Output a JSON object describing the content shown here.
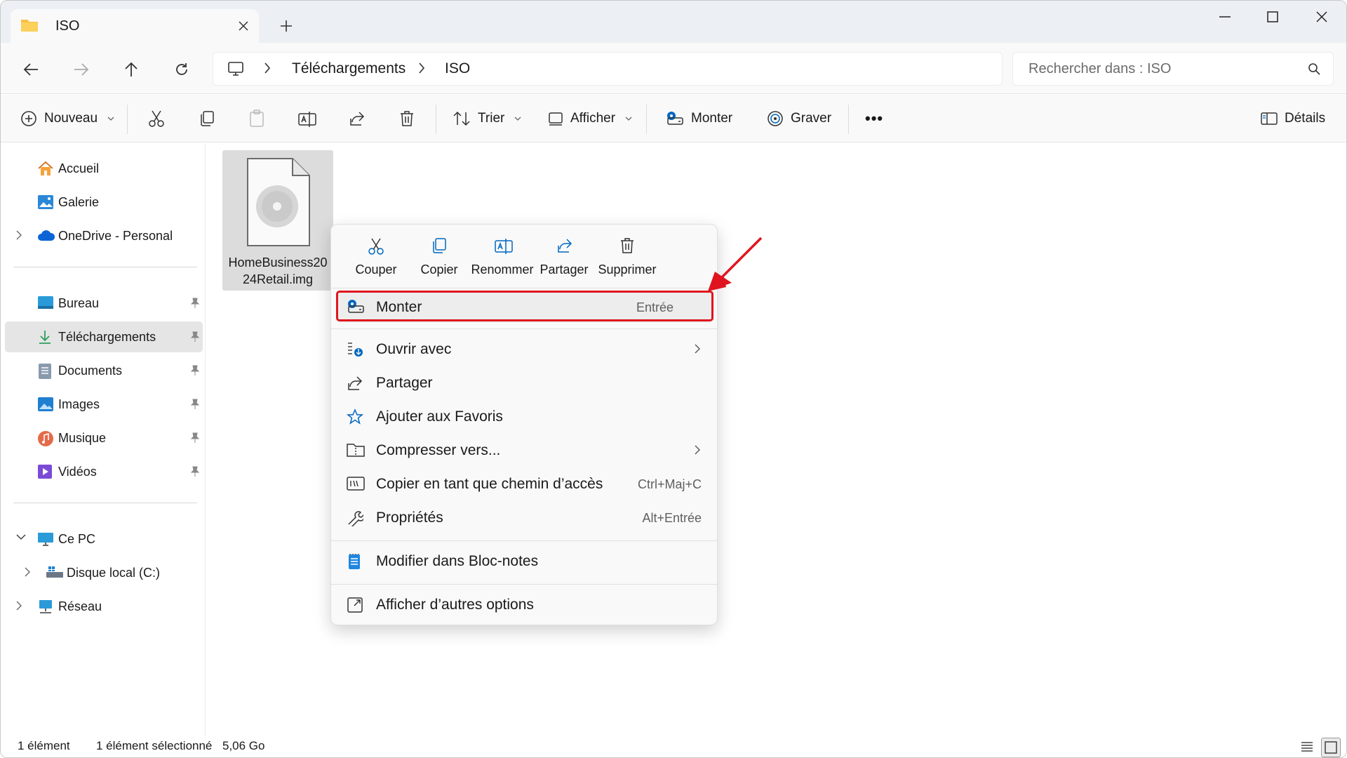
{
  "window": {
    "tab_title": "ISO",
    "colors": {
      "accent": "#0067c0",
      "highlight_red": "#e0141e"
    }
  },
  "address": {
    "breadcrumb": [
      "Téléchargements",
      "ISO"
    ],
    "search_placeholder": "Rechercher dans : ISO"
  },
  "toolbar": {
    "new_label": "Nouveau",
    "sort_label": "Trier",
    "view_label": "Afficher",
    "mount_label": "Monter",
    "burn_label": "Graver",
    "details_label": "Détails",
    "more_label": "•••"
  },
  "sidebar": {
    "items": [
      {
        "label": "Accueil",
        "icon": "home-icon"
      },
      {
        "label": "Galerie",
        "icon": "gallery-icon"
      },
      {
        "label": "OneDrive - Personal",
        "icon": "cloud-icon"
      },
      {
        "label": "Bureau",
        "icon": "desktop-icon"
      },
      {
        "label": "Téléchargements",
        "icon": "download-icon"
      },
      {
        "label": "Documents",
        "icon": "documents-icon"
      },
      {
        "label": "Images",
        "icon": "pictures-icon"
      },
      {
        "label": "Musique",
        "icon": "music-icon"
      },
      {
        "label": "Vidéos",
        "icon": "videos-icon"
      },
      {
        "label": "Ce PC",
        "icon": "computer-icon"
      },
      {
        "label": "Disque local (C:)",
        "icon": "drive-icon"
      },
      {
        "label": "Réseau",
        "icon": "network-icon"
      }
    ]
  },
  "file": {
    "name_line1": "HomeBusiness20",
    "name_line2": "24Retail.img"
  },
  "context_menu": {
    "quick_actions": [
      "Couper",
      "Copier",
      "Renommer",
      "Partager",
      "Supprimer"
    ],
    "items": [
      {
        "label": "Monter",
        "shortcut": "Entrée"
      },
      {
        "label": "Ouvrir avec",
        "shortcut": ""
      },
      {
        "label": "Partager",
        "shortcut": ""
      },
      {
        "label": "Ajouter aux Favoris",
        "shortcut": ""
      },
      {
        "label": "Compresser vers...",
        "shortcut": ""
      },
      {
        "label": "Copier en tant que chemin d’accès",
        "shortcut": "Ctrl+Maj+C"
      },
      {
        "label": "Propriétés",
        "shortcut": "Alt+Entrée"
      },
      {
        "label": "Modifier dans Bloc-notes",
        "shortcut": ""
      },
      {
        "label": "Afficher d’autres options",
        "shortcut": ""
      }
    ]
  },
  "status": {
    "count": "1 élément",
    "selected": "1 élément sélectionné",
    "size": "5,06 Go"
  }
}
